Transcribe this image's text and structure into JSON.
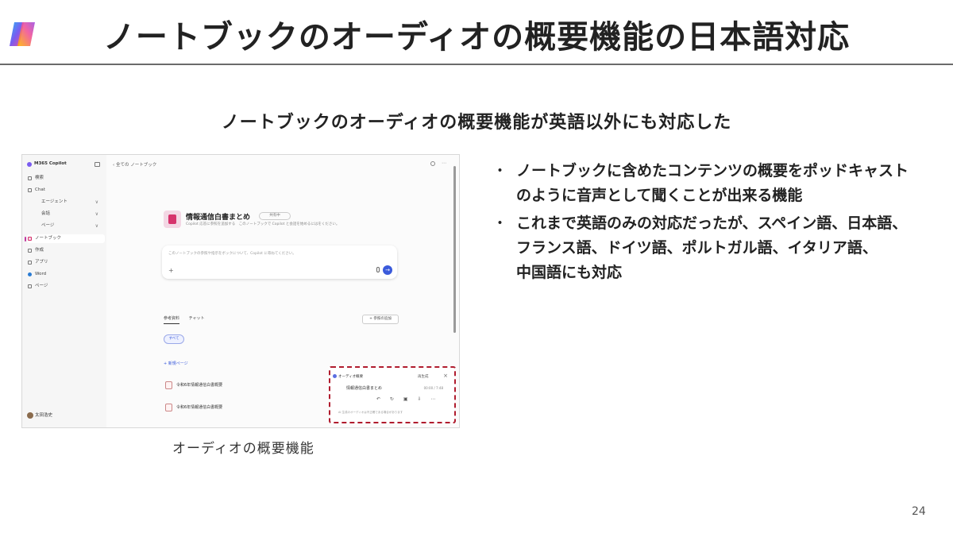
{
  "slide": {
    "title": "ノートブックのオーディオの概要機能の日本語対応",
    "subtitle": "ノートブックのオーディオの概要機能が英語以外にも対応した",
    "caption": "オーディオの概要機能",
    "page_number": "24",
    "bullet_marker": "・",
    "bullets": [
      "ノートブックに含めたコンテンツの概要をポッドキャスト\nのように音声として聞くことが出来る機能",
      "これまで英語のみの対応だったが、スペイン語、日本語、\nフランス語、ドイツ語、ポルトガル語、イタリア語、\n中国語にも対応"
    ]
  },
  "screenshot": {
    "sidebar": {
      "app_name": "M365 Copilot",
      "items": [
        {
          "label": "検索"
        },
        {
          "label": "Chat"
        },
        {
          "label": "エージェント",
          "chev": "∨"
        },
        {
          "label": "会話",
          "chev": "∨"
        },
        {
          "label": "ページ",
          "chev": "∨"
        },
        {
          "label": "ノートブック"
        },
        {
          "label": "作成"
        },
        {
          "label": "アプリ"
        },
        {
          "label": "Word"
        },
        {
          "label": "ページ"
        }
      ],
      "user_name": "太田浩史"
    },
    "main": {
      "breadcrumb": "‹ 全ての ノートブック",
      "notebook_title": "情報通信白書まとめ",
      "share_label": "共有中",
      "notebook_desc": "Copilot 応答に参照を追加する　このノートブックで Copilot と会話を始めるにはをください。",
      "prompt_placeholder": "このノートブックの参照や指示をボックについて、Copilot に尋ねてください。",
      "prompt_plus": "+",
      "send_glyph": "→",
      "tabs": [
        "参考資料",
        "チャット"
      ],
      "add_ref_label": "+ 参照の追加",
      "filter_chip": "すべて",
      "new_page_label": "+ 新規ページ",
      "files": [
        "令和6年情報通信白書概要",
        "令和6年情報通信白書概要"
      ]
    },
    "audio_panel": {
      "title": "オーディオ概要",
      "regenerate_label": "再生成",
      "close_glyph": "×",
      "track_name": "情報通信白書まとめ",
      "time": "00:00 / 7:48",
      "controls": "↶ ↻ ▣ ⇩ ⋯",
      "note": "AI 生成のオーディオは不正確である場合があります"
    }
  },
  "colors": {
    "accent": "#3b5bdb",
    "highlight_border": "#b01c2e",
    "notebook": "#d6336c"
  }
}
